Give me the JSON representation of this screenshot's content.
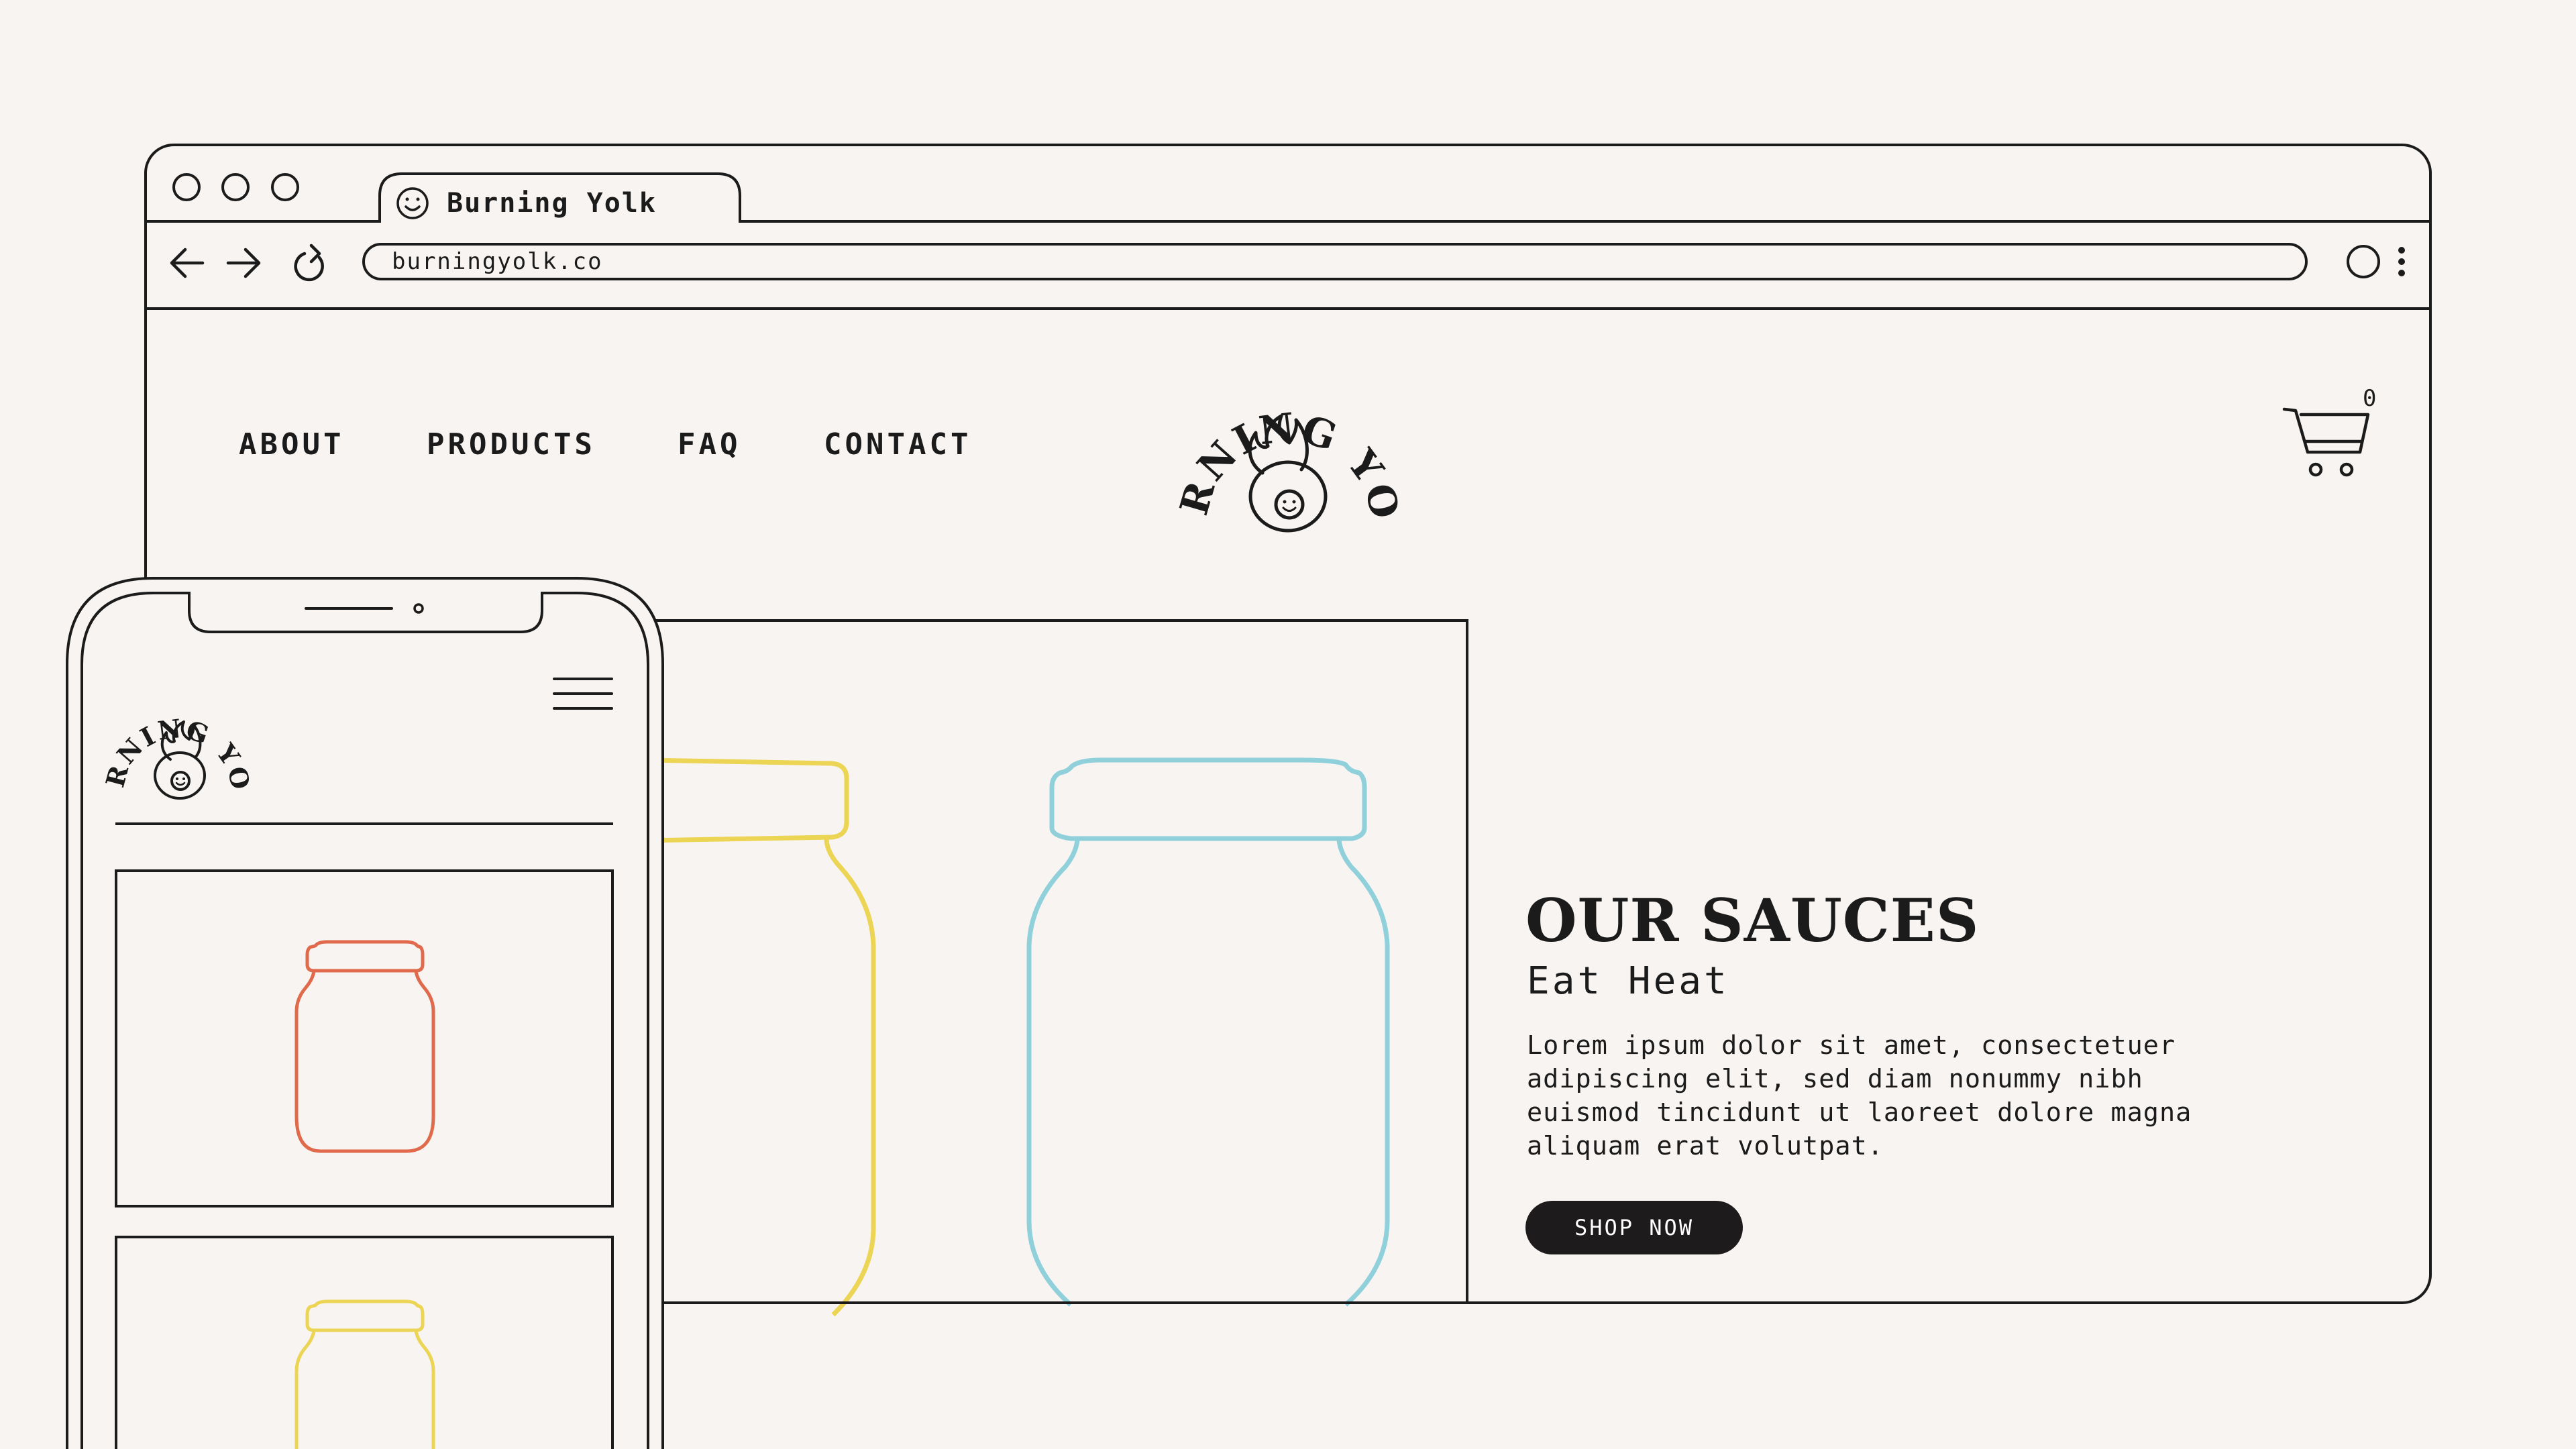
{
  "browser": {
    "tab_title": "Burning Yolk",
    "url": "burningyolk.co"
  },
  "logo": {
    "wordmark": "BURNING YOLK"
  },
  "nav": {
    "items": [
      {
        "label": "ABOUT"
      },
      {
        "label": "PRODUCTS"
      },
      {
        "label": "FAQ"
      },
      {
        "label": "CONTACT"
      }
    ]
  },
  "cart": {
    "count": "0"
  },
  "hero": {
    "title": "OUR SAUCES",
    "subtitle": "Eat Heat",
    "body": "Lorem ipsum dolor sit amet, consectetuer adipiscing elit, sed diam nonummy nibh euismod tincidunt ut laoreet dolore magna aliquam erat volutpat.",
    "button_label": "SHOP NOW"
  },
  "colors": {
    "ink": "#1b1b1b",
    "background": "#f7f4f2",
    "jar_yellow": "#ecd454",
    "jar_blue": "#8fd0db",
    "jar_red": "#e06a4c",
    "button": "#1d1b1c"
  },
  "icons": {
    "window_controls": [
      "circle-icon",
      "circle-icon",
      "circle-icon"
    ],
    "tab_favicon": "smiley-icon",
    "back": "arrow-left-icon",
    "forward": "arrow-right-icon",
    "reload": "reload-icon",
    "profile": "circle-icon",
    "browser_menu": "kebab-menu-icon",
    "cart": "cart-icon",
    "mobile_menu": "hamburger-menu-icon"
  }
}
